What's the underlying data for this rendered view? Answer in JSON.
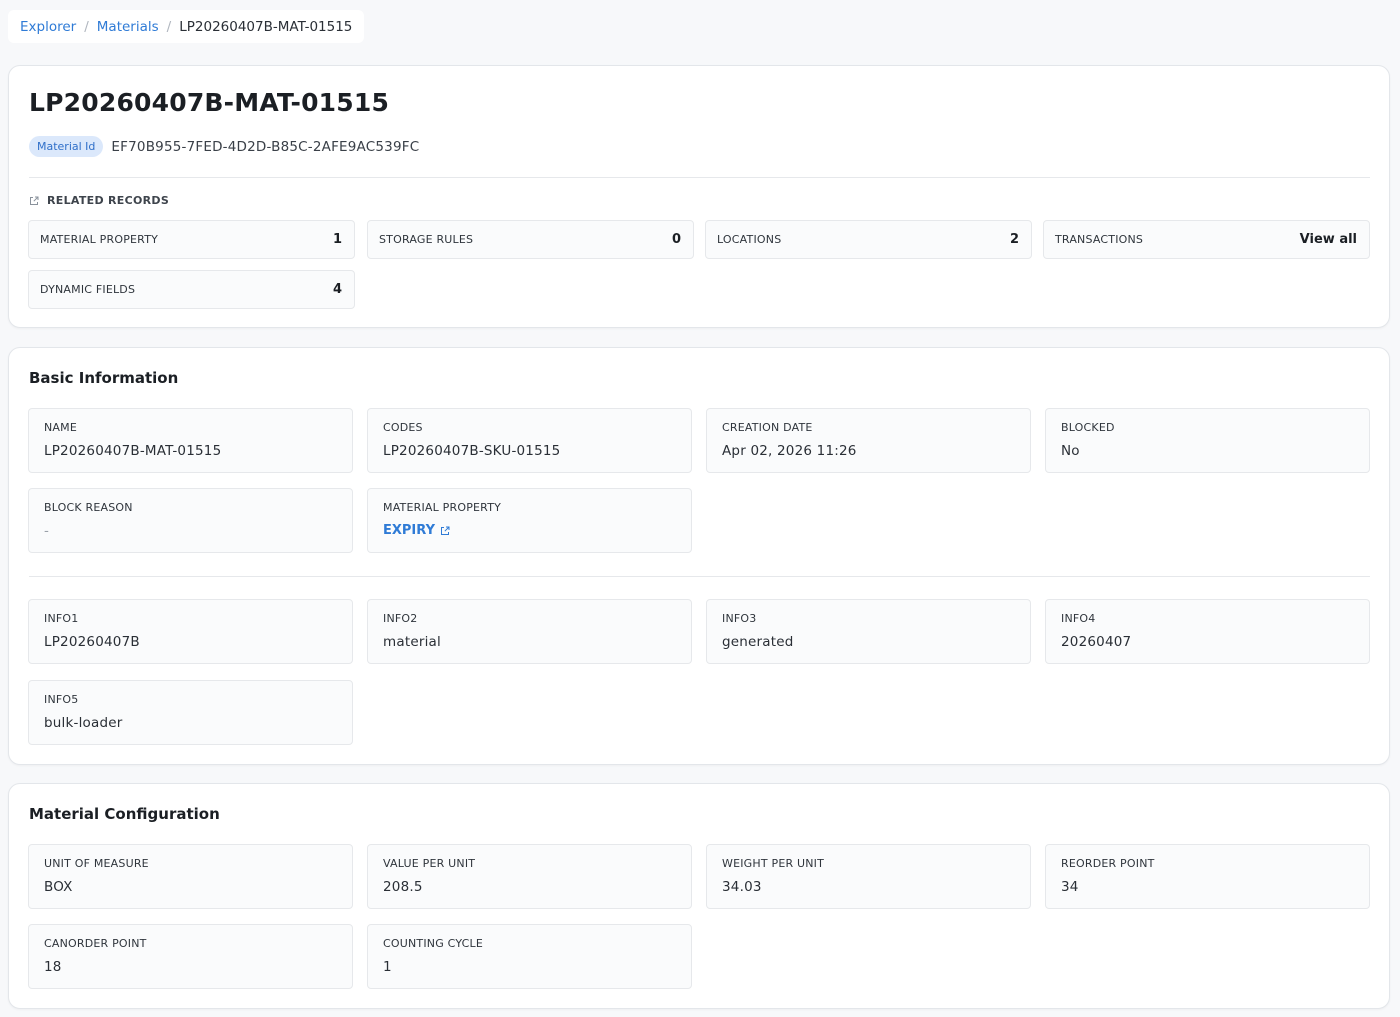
{
  "breadcrumb": {
    "items": [
      "Explorer",
      "Materials"
    ],
    "current": "LP20260407B-MAT-01515",
    "separator": "/"
  },
  "header": {
    "title": "LP20260407B-MAT-01515",
    "id_badge": "Material Id",
    "id_value": "EF70B955-7FED-4D2D-B85C-2AFE9AC539FC",
    "related_heading": "RELATED RECORDS",
    "related": [
      {
        "label": "MATERIAL PROPERTY",
        "value": "1"
      },
      {
        "label": "STORAGE RULES",
        "value": "0"
      },
      {
        "label": "LOCATIONS",
        "value": "2"
      },
      {
        "label": "TRANSACTIONS",
        "value": "View all"
      },
      {
        "label": "DYNAMIC FIELDS",
        "value": "4"
      }
    ]
  },
  "basic": {
    "title": "Basic Information",
    "fields": [
      {
        "label": "NAME",
        "value": "LP20260407B-MAT-01515"
      },
      {
        "label": "CODES",
        "value": "LP20260407B-SKU-01515"
      },
      {
        "label": "CREATION DATE",
        "value": "Apr 02, 2026 11:26"
      },
      {
        "label": "BLOCKED",
        "value": "No"
      },
      {
        "label": "BLOCK REASON",
        "value": "-"
      },
      {
        "label": "MATERIAL PROPERTY",
        "value": "EXPIRY"
      }
    ],
    "info": [
      {
        "label": "INFO1",
        "value": "LP20260407B"
      },
      {
        "label": "INFO2",
        "value": "material"
      },
      {
        "label": "INFO3",
        "value": "generated"
      },
      {
        "label": "INFO4",
        "value": "20260407"
      },
      {
        "label": "INFO5",
        "value": "bulk-loader"
      }
    ]
  },
  "config": {
    "title": "Material Configuration",
    "fields": [
      {
        "label": "UNIT OF MEASURE",
        "value": "BOX"
      },
      {
        "label": "VALUE PER UNIT",
        "value": "208.5"
      },
      {
        "label": "WEIGHT PER UNIT",
        "value": "34.03"
      },
      {
        "label": "REORDER POINT",
        "value": "34"
      },
      {
        "label": "CANORDER POINT",
        "value": "18"
      },
      {
        "label": "COUNTING CYCLE",
        "value": "1"
      }
    ]
  },
  "icons": {
    "related": "external-link-icon",
    "material_property_link": "external-link-icon"
  },
  "colors": {
    "link": "#2f7bd6",
    "badge_bg": "#dbe8fb",
    "badge_text": "#2f6fc9",
    "page_bg": "#f7f8fa"
  }
}
